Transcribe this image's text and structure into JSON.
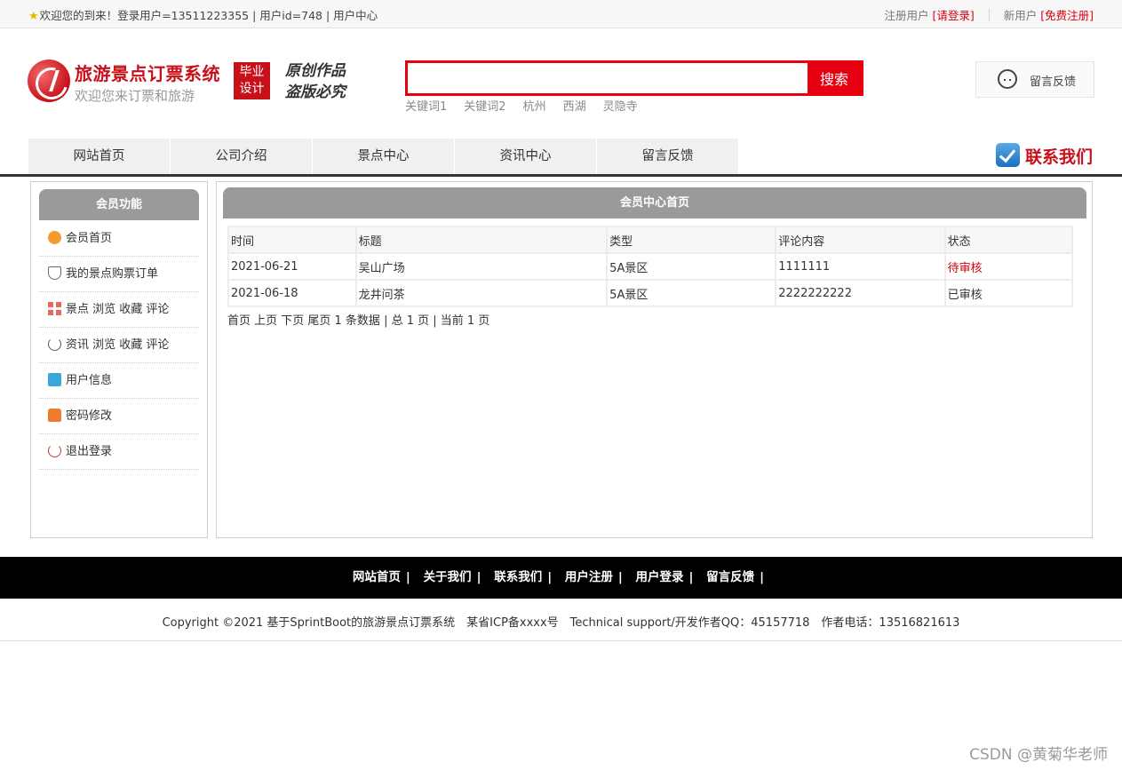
{
  "topbar": {
    "welcome": "欢迎您的到来！登录用户=13511223355 | 用户id=748 | 用户中心",
    "registered_user": "注册用户",
    "login_link": "[请登录]",
    "new_user": "新用户",
    "register_link": "[免费注册]"
  },
  "header": {
    "site_title": "旅游景点订票系统",
    "site_subtitle": "欢迎您来订票和旅游",
    "badge_line1": "毕业",
    "badge_line2": "设计",
    "slogan_line1": "原创作品",
    "slogan_line2": "盗版必究",
    "search_value": "",
    "search_button": "搜索",
    "hot_words": [
      "关键词1",
      "关键词2",
      "杭州",
      "西湖",
      "灵隐寺"
    ],
    "feedback": "留言反馈"
  },
  "nav": {
    "items": [
      "网站首页",
      "公司介绍",
      "景点中心",
      "资讯中心",
      "留言反馈"
    ],
    "contact": "联系我们"
  },
  "sidebar": {
    "title": "会员功能",
    "items": [
      {
        "label": "会员首页",
        "icon": "home-icon"
      },
      {
        "label": "我的景点购票订单",
        "icon": "order-icon"
      },
      {
        "label": "景点 浏览 收藏 评论",
        "icon": "grid-icon"
      },
      {
        "label": "资讯 浏览 收藏 评论",
        "icon": "refresh-icon"
      },
      {
        "label": "用户信息",
        "icon": "user-info-icon"
      },
      {
        "label": "密码修改",
        "icon": "lock-icon"
      },
      {
        "label": "退出登录",
        "icon": "power-icon"
      }
    ]
  },
  "main": {
    "title": "会员中心首页",
    "columns": [
      "时间",
      "标题",
      "类型",
      "评论内容",
      "状态"
    ],
    "rows": [
      {
        "time": "2021-06-21",
        "title": "吴山广场",
        "type": "5A景区",
        "comment": "1111111",
        "status": "待审核"
      },
      {
        "time": "2021-06-18",
        "title": "龙井问茶",
        "type": "5A景区",
        "comment": "2222222222",
        "status": "已审核"
      }
    ],
    "pager": "首页 上页 下页 尾页 1 条数据 | 总 1 页 | 当前 1 页"
  },
  "footer": {
    "links": [
      "网站首页",
      "关于我们",
      "联系我们",
      "用户注册",
      "用户登录",
      "留言反馈"
    ],
    "copyright": "Copyright ©2021 基于SprintBoot的旅游景点订票系统　某省ICP备xxxx号　Technical support/开发作者QQ：45157718　作者电话：13516821613",
    "watermark": "CSDN @黄菊华老师"
  },
  "colors": {
    "brand_red": "#c8101a",
    "search_red": "#e60012",
    "panel_gray": "#9a9a9a",
    "pending_status": "#d9000f"
  }
}
